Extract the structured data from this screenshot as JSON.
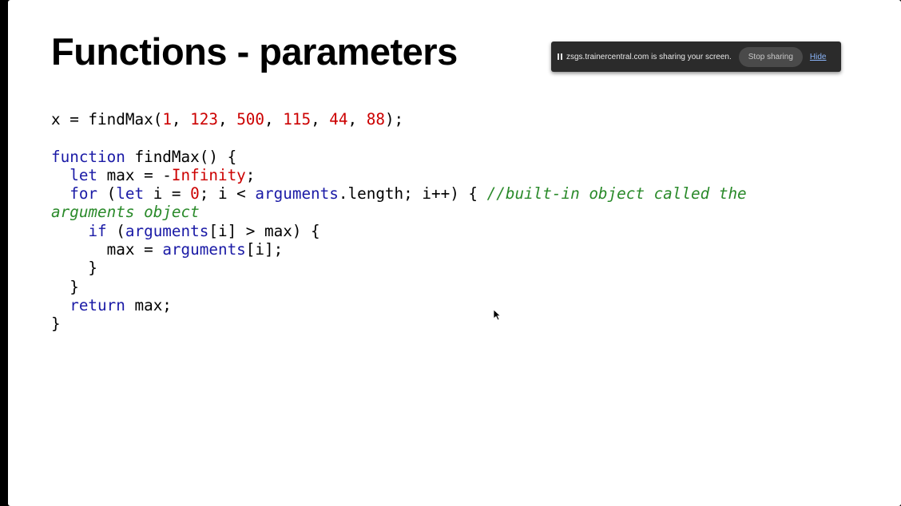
{
  "slide": {
    "title": "Functions - parameters"
  },
  "share_bar": {
    "message": "zsgs.trainercentral.com is sharing your screen.",
    "stop_label": "Stop sharing",
    "hide_label": "Hide"
  },
  "code": {
    "l1": {
      "a": "x = findMax(",
      "n1": "1",
      "s1": ", ",
      "n2": "123",
      "s2": ", ",
      "n3": "500",
      "s3": ", ",
      "n4": "115",
      "s4": ", ",
      "n5": "44",
      "s5": ", ",
      "n6": "88",
      "end": ");"
    },
    "l2": {
      "kw": "function",
      "rest": " findMax() {"
    },
    "l3": {
      "ind": "  ",
      "kw": "let",
      "mid": " max = -",
      "num": "Infinity",
      "end": ";"
    },
    "l4": {
      "ind": "  ",
      "kw1": "for",
      "a": " (",
      "kw2": "let",
      "b": " i = ",
      "num": "0",
      "c": "; i < ",
      "kw3": "arguments",
      "d": ".length; i++) { ",
      "comment": "//built-in object called the"
    },
    "l5": {
      "comment": "arguments object"
    },
    "l6": {
      "ind": "    ",
      "kw1": "if",
      "a": " (",
      "kw2": "arguments",
      "b": "[i] > max) {"
    },
    "l7": {
      "ind": "      ",
      "a": "max = ",
      "kw": "arguments",
      "b": "[i];"
    },
    "l8": {
      "text": "    }"
    },
    "l9": {
      "text": "  }"
    },
    "l10": {
      "ind": "  ",
      "kw": "return",
      "rest": " max;"
    },
    "l11": {
      "text": "}"
    }
  },
  "colors": {
    "keyword": "#1a1aa6",
    "number": "#cc0000",
    "comment": "#2a8a2a"
  },
  "icons": {
    "pause": "pause-icon",
    "cursor": "mouse-pointer-icon"
  }
}
